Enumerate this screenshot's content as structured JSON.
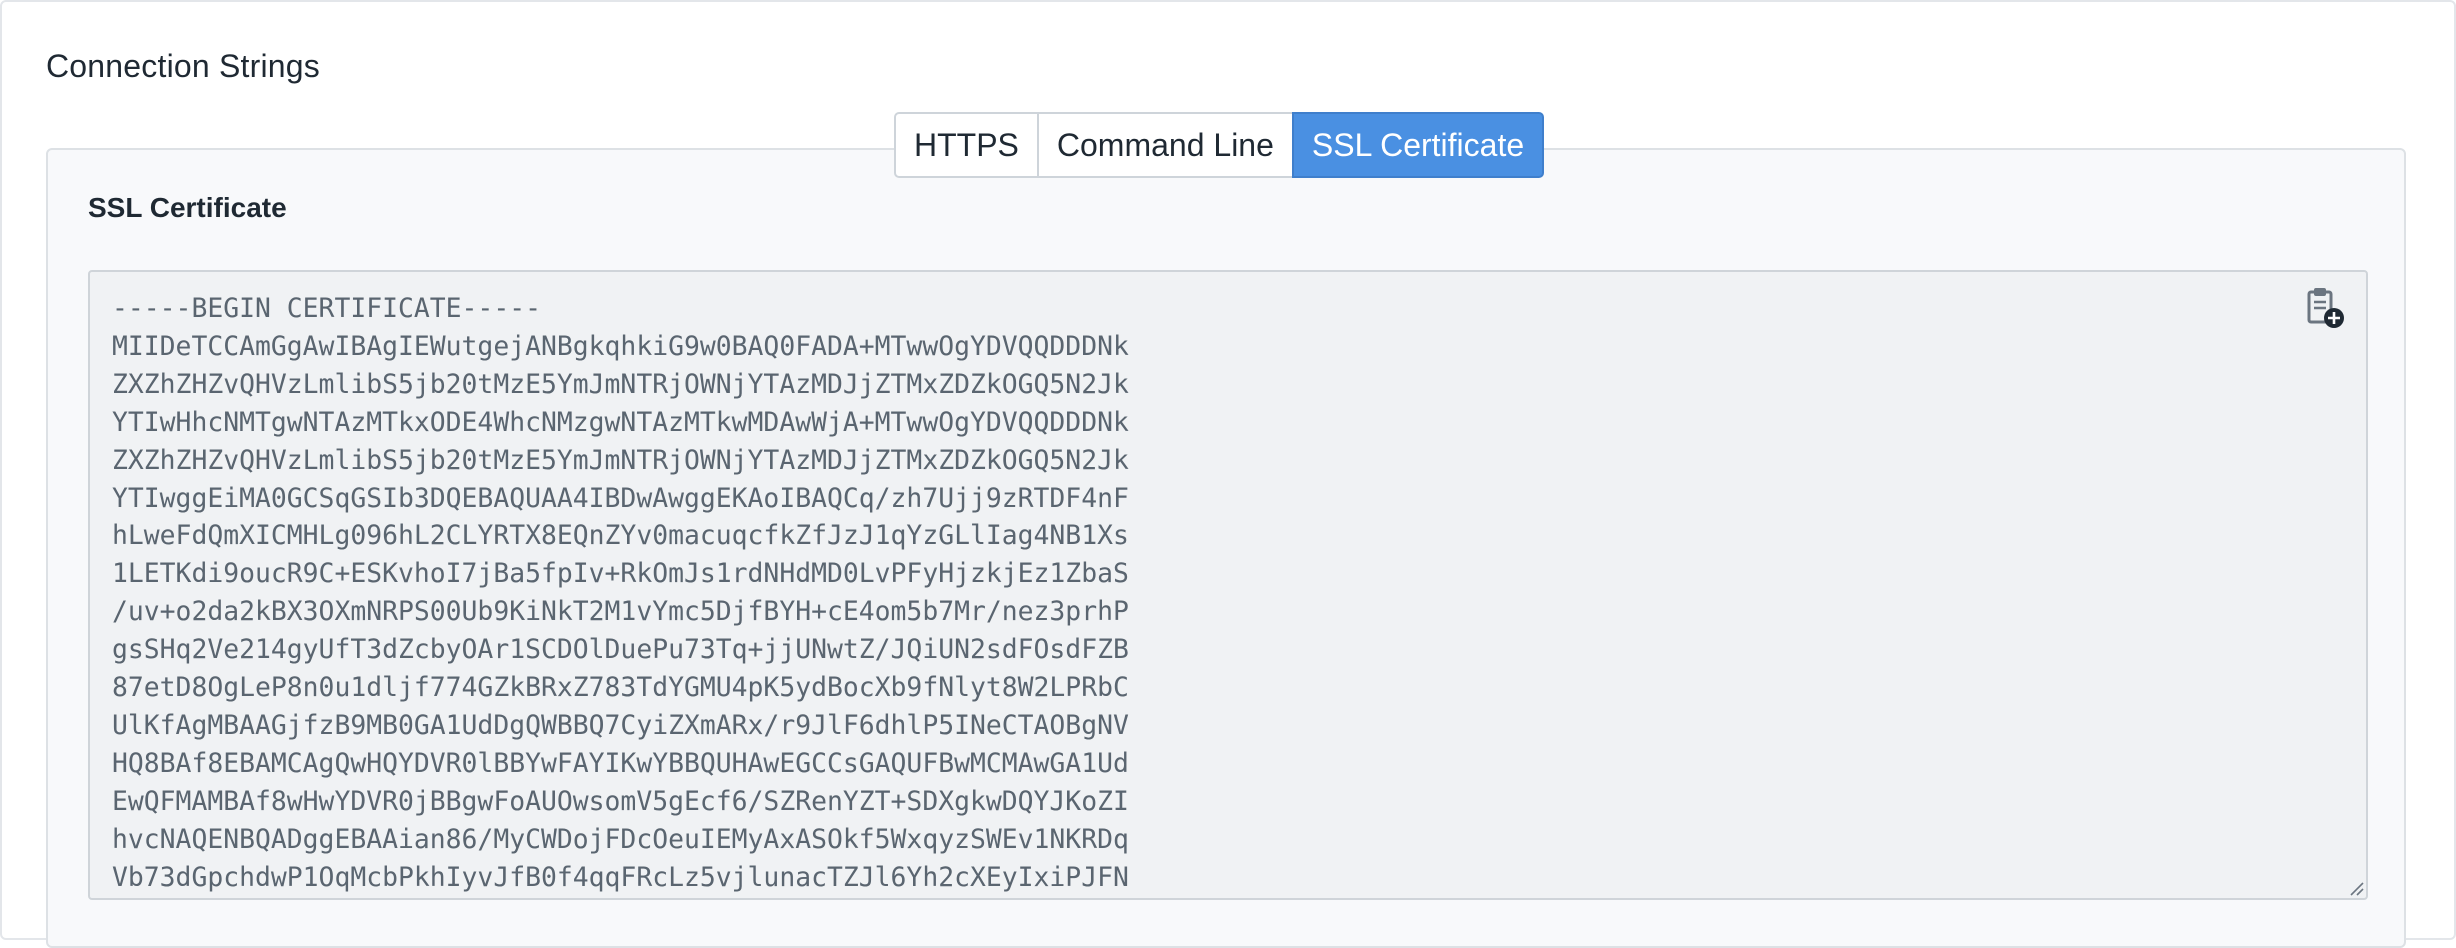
{
  "section": {
    "title": "Connection Strings"
  },
  "tabs": [
    {
      "label": "HTTPS",
      "active": false
    },
    {
      "label": "Command Line",
      "active": false
    },
    {
      "label": "SSL Certificate",
      "active": true
    }
  ],
  "certificate": {
    "label": "SSL Certificate",
    "text": "-----BEGIN CERTIFICATE-----\nMIIDeTCCAmGgAwIBAgIEWutgejANBgkqhkiG9w0BAQ0FADA+MTwwOgYDVQQDDDNk\nZXZhZHZvQHVzLmlibS5jb20tMzE5YmJmNTRjOWNjYTAzMDJjZTMxZDZkOGQ5N2Jk\nYTIwHhcNMTgwNTAzMTkxODE4WhcNMzgwNTAzMTkwMDAwWjA+MTwwOgYDVQQDDDNk\nZXZhZHZvQHVzLmlibS5jb20tMzE5YmJmNTRjOWNjYTAzMDJjZTMxZDZkOGQ5N2Jk\nYTIwggEiMA0GCSqGSIb3DQEBAQUAA4IBDwAwggEKAoIBAQCq/zh7Ujj9zRTDF4nF\nhLweFdQmXICMHLg096hL2CLYRTX8EQnZYv0macuqcfkZfJzJ1qYzGLlIag4NB1Xs\n1LETKdi9oucR9C+ESKvhoI7jBa5fpIv+RkOmJs1rdNHdMD0LvPFyHjzkjEz1ZbaS\n/uv+o2da2kBX3OXmNRPS00Ub9KiNkT2M1vYmc5DjfBYH+cE4om5b7Mr/nez3prhP\ngsSHq2Ve214gyUfT3dZcbyOAr1SCDOlDuePu73Tq+jjUNwtZ/JQiUN2sdFOsdFZB\n87etD8OgLeP8n0u1dljf774GZkBRxZ783TdYGMU4pK5ydBocXb9fNlyt8W2LPRbC\nUlKfAgMBAAGjfzB9MB0GA1UdDgQWBBQ7CyiZXmARx/r9JlF6dhlP5INeCTAOBgNV\nHQ8BAf8EBAMCAgQwHQYDVR0lBBYwFAYIKwYBBQUHAwEGCCsGAQUFBwMCMAwGA1Ud\nEwQFMAMBAf8wHwYDVR0jBBgwFoAUOwsomV5gEcf6/SZRenYZT+SDXgkwDQYJKoZI\nhvcNAQENBQADggEBAAian86/MyCWDojFDcOeuIEMyAxASOkf5WxqyzSWEv1NKRDq\nVb73dGpchdwP1OqMcbPkhIyvJfB0f4qqFRcLz5vjlunacTZJl6Yh2cXEyIxiPJFN"
  },
  "icons": {
    "copy": "clipboard-plus-icon",
    "resize": "resize-grip-icon"
  },
  "colors": {
    "accent": "#4a90e2",
    "panel_bg": "#f8f9fb",
    "textarea_bg": "#f0f2f4",
    "text": "#1f2933",
    "mono_text": "#5a6570"
  }
}
